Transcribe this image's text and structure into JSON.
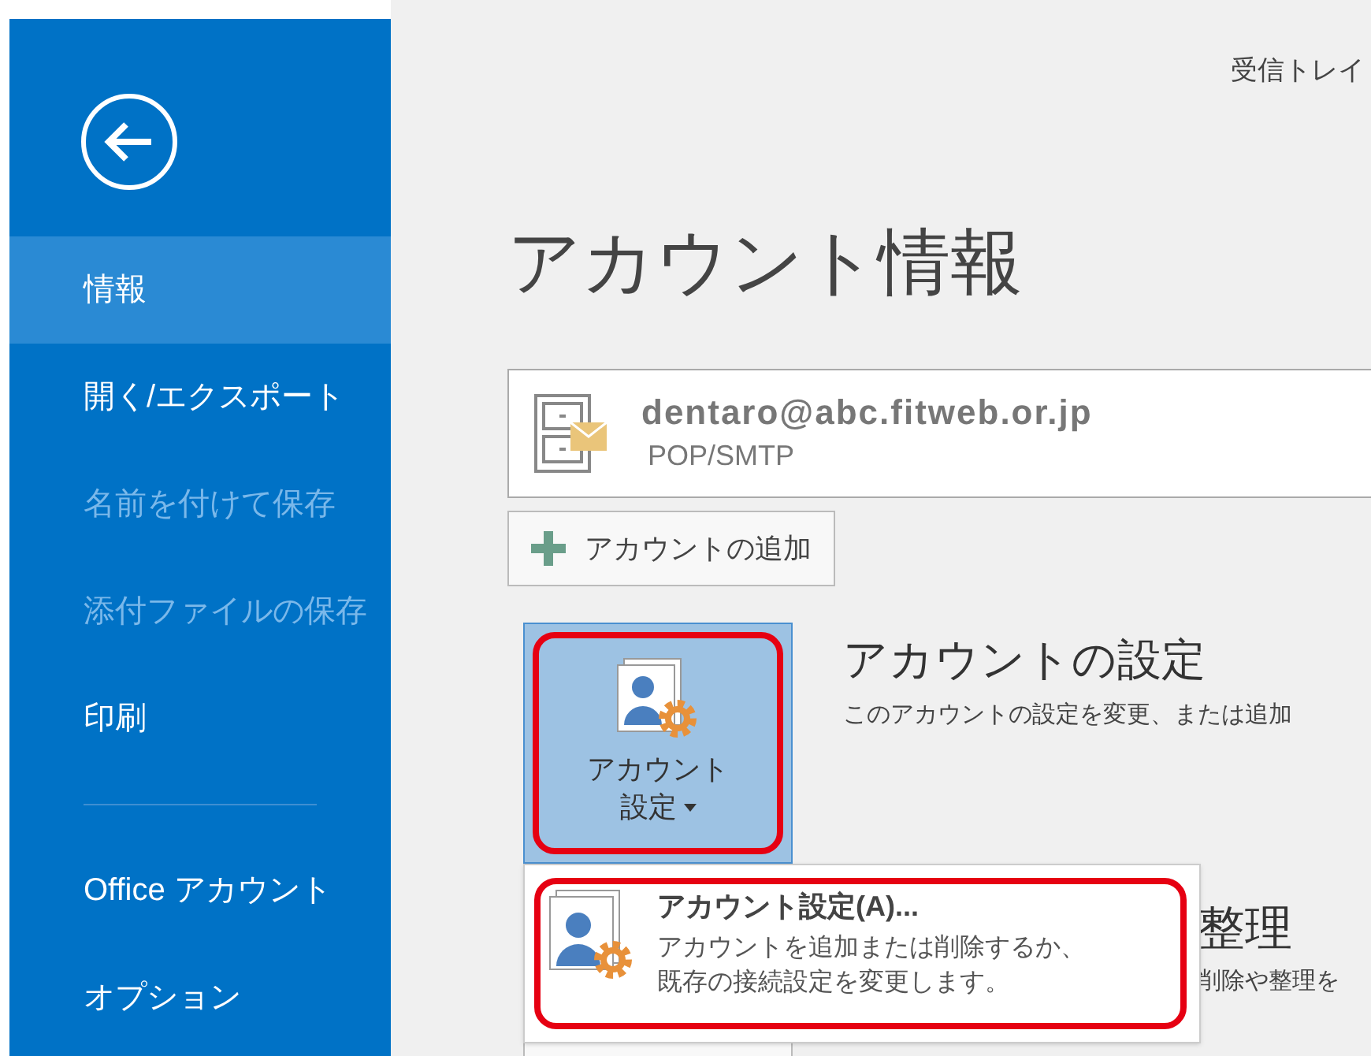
{
  "sidebar": {
    "sections": [
      [
        {
          "label": "情報",
          "selected": true,
          "disabled": false
        },
        {
          "label": "開く/エクスポート",
          "selected": false,
          "disabled": false
        },
        {
          "label": "名前を付けて保存",
          "selected": false,
          "disabled": true
        },
        {
          "label": "添付ファイルの保存",
          "selected": false,
          "disabled": true
        },
        {
          "label": "印刷",
          "selected": false,
          "disabled": false
        }
      ],
      [
        {
          "label": "Office アカウント",
          "selected": false,
          "disabled": false
        },
        {
          "label": "オプション",
          "selected": false,
          "disabled": false
        }
      ]
    ]
  },
  "header": {
    "folder": "受信トレイ"
  },
  "page_title": "アカウント情報",
  "account": {
    "email": "dentaro@abc.fitweb.or.jp",
    "type": "POP/SMTP"
  },
  "add_account_button": "アカウントの追加",
  "account_settings": {
    "button_lines": [
      "アカウント",
      "設定"
    ],
    "heading": "アカウントの設定",
    "description": "このアカウントの設定を変更、または追加"
  },
  "menu": {
    "items": [
      {
        "label": "アカウント設定(A)...",
        "description_lines": [
          "アカウントを追加または削除するか、",
          "既存の接続設定を変更します。"
        ]
      }
    ]
  },
  "cleanup": {
    "heading_visible": "整理",
    "description_visible": "削除や整理を"
  }
}
